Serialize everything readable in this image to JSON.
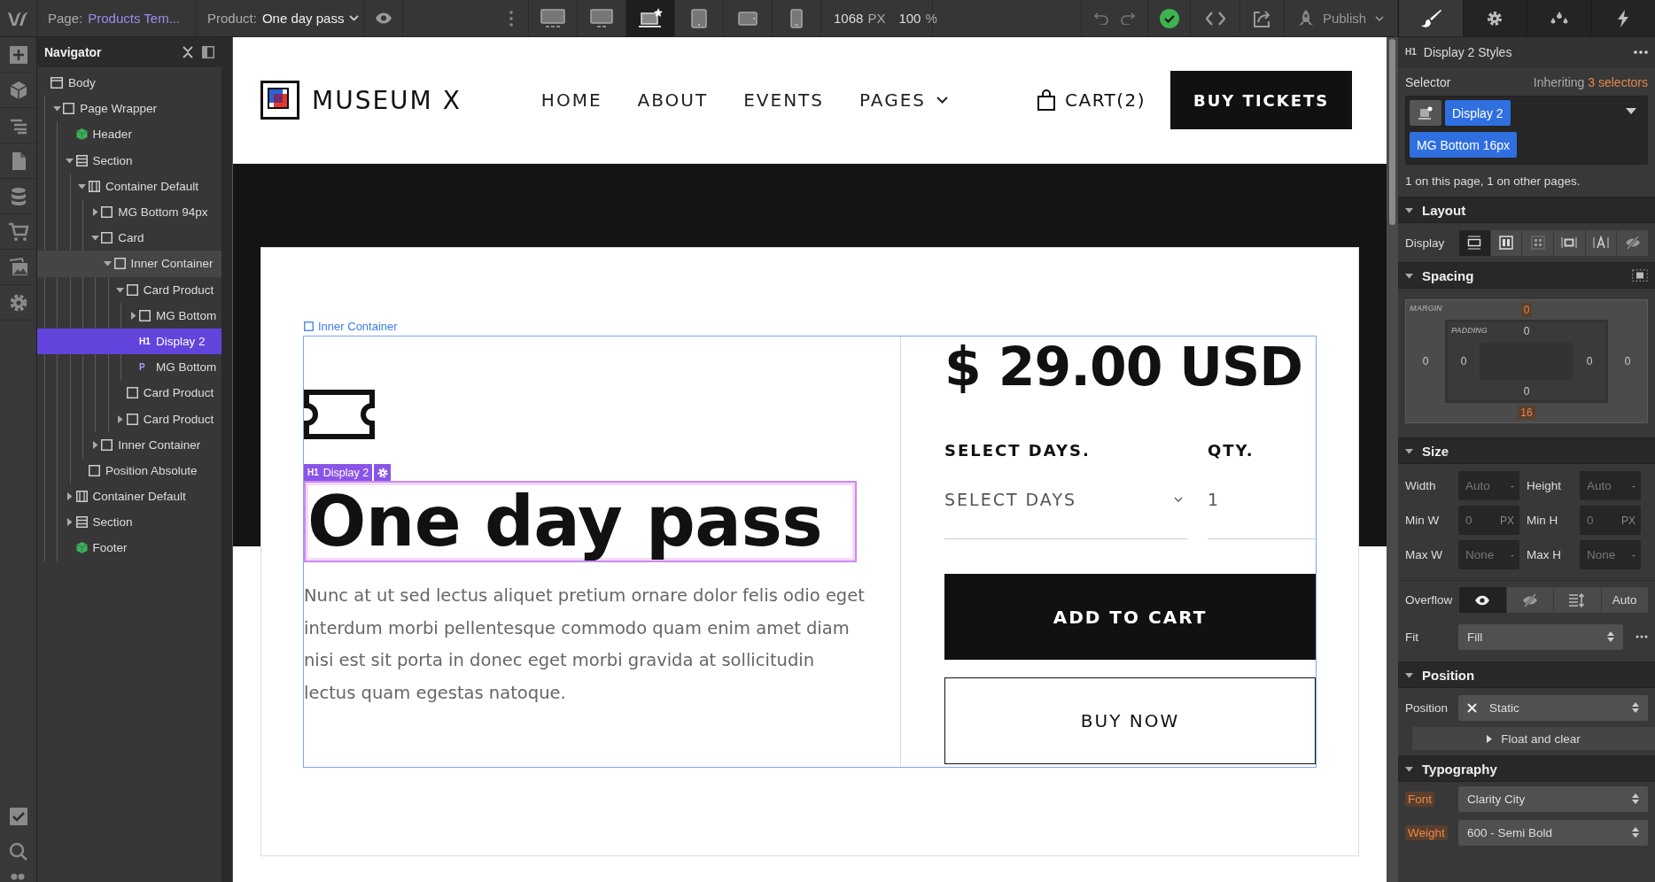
{
  "topbar": {
    "page_label": "Page:",
    "page_name": "Products Tem...",
    "product_label": "Product:",
    "product_name": "One day pass",
    "devices": [
      {
        "selected": false
      },
      {
        "selected": false
      },
      {
        "selected": true
      },
      {
        "selected": false
      },
      {
        "selected": false
      },
      {
        "selected": false
      }
    ],
    "width_value": "1068",
    "width_unit": "PX",
    "zoom_value": "100",
    "zoom_unit": "%",
    "publish": "Publish"
  },
  "panel_tabs": [
    {
      "selected": true
    },
    {
      "selected": false
    },
    {
      "selected": false
    },
    {
      "selected": false
    }
  ],
  "navigator": {
    "title": "Navigator",
    "items": [
      {
        "label": "Body",
        "kind": "body",
        "selected": false,
        "highlighted": false,
        "children": [
          {
            "label": "Page Wrapper",
            "kind": "box",
            "expanded": true,
            "selected": false,
            "highlighted": false,
            "children": [
              {
                "label": "Header",
                "kind": "component",
                "selected": false,
                "highlighted": false
              },
              {
                "label": "Section",
                "kind": "section",
                "expanded": true,
                "selected": false,
                "highlighted": false,
                "children": [
                  {
                    "label": "Container Default",
                    "kind": "container",
                    "expanded": true,
                    "selected": false,
                    "highlighted": false,
                    "children": [
                      {
                        "label": "MG Bottom 94px",
                        "kind": "box",
                        "expanded": false,
                        "selected": false,
                        "highlighted": false
                      },
                      {
                        "label": "Card",
                        "kind": "box",
                        "expanded": true,
                        "selected": false,
                        "highlighted": false,
                        "children": [
                          {
                            "label": "Inner Container",
                            "kind": "box",
                            "expanded": true,
                            "selected": false,
                            "highlighted": true,
                            "children": [
                              {
                                "label": "Card Product",
                                "kind": "box",
                                "expanded": true,
                                "selected": false,
                                "highlighted": false,
                                "children": [
                                  {
                                    "label": "MG Bottom",
                                    "kind": "box",
                                    "expanded": false,
                                    "selected": false,
                                    "highlighted": false
                                  },
                                  {
                                    "label": "Display 2",
                                    "kind": "tag",
                                    "tag": "H1",
                                    "selected": true,
                                    "highlighted": false
                                  },
                                  {
                                    "label": "MG Bottom",
                                    "kind": "tag",
                                    "tag": "P",
                                    "selected": false,
                                    "highlighted": false
                                  }
                                ]
                              },
                              {
                                "label": "Card Product",
                                "kind": "box",
                                "selected": false,
                                "highlighted": false
                              },
                              {
                                "label": "Card Product",
                                "kind": "box",
                                "expanded": false,
                                "selected": false,
                                "highlighted": false
                              }
                            ]
                          }
                        ]
                      },
                      {
                        "label": "Inner Container",
                        "kind": "box",
                        "expanded": false,
                        "selected": false,
                        "highlighted": false
                      }
                    ]
                  },
                  {
                    "label": "Position Absolute",
                    "kind": "box",
                    "selected": false,
                    "highlighted": false
                  }
                ]
              },
              {
                "label": "Container Default",
                "kind": "container",
                "expanded": false,
                "selected": false,
                "highlighted": false
              },
              {
                "label": "Section",
                "kind": "section",
                "expanded": false,
                "selected": false,
                "highlighted": false
              },
              {
                "label": "Footer",
                "kind": "component",
                "selected": false,
                "highlighted": false
              }
            ]
          }
        ]
      }
    ]
  },
  "site": {
    "brand": "MUSEUM X",
    "nav": [
      {
        "label": "HOME",
        "dropdown": false
      },
      {
        "label": "ABOUT",
        "dropdown": false
      },
      {
        "label": "EVENTS",
        "dropdown": false
      },
      {
        "label": "PAGES",
        "dropdown": true
      }
    ],
    "cart": "CART(2)",
    "cta": "BUY TICKETS"
  },
  "selection": {
    "parent_label": "Inner Container",
    "tag": "H1",
    "label": "Display 2"
  },
  "product": {
    "title": "One day pass",
    "description": "Nunc at ut sed lectus aliquet pretium ornare dolor felis odio eget interdum morbi pellentesque commodo quam enim amet diam nisi est sit porta in donec eget morbi gravida at sollicitudin lectus quam egestas natoque.",
    "price": "$ 29.00 USD",
    "days_label": "SELECT DAYS.",
    "qty_label": "QTY.",
    "days_placeholder": "SELECT DAYS",
    "qty_value": "1",
    "add_button": "ADD TO CART",
    "buy_button": "BUY NOW"
  },
  "style_panel": {
    "tag": "H1",
    "title": "Display 2 Styles",
    "selector_label": "Selector",
    "inheriting_prefix": "Inheriting",
    "inheriting_count": "3 selectors",
    "selectors": [
      "Display 2",
      "MG Bottom 16px"
    ],
    "usage": "1 on this page, 1 on other pages.",
    "layout": {
      "title": "Layout",
      "display_label": "Display",
      "display_options": [
        {
          "selected": true
        },
        {
          "selected": false
        },
        {
          "selected": false
        },
        {
          "selected": false
        },
        {
          "selected": false
        },
        {
          "selected": false
        }
      ]
    },
    "spacing": {
      "title": "Spacing",
      "margin_label": "MARGIN",
      "padding_label": "PADDING",
      "margin": {
        "top": {
          "value": "0",
          "set": true
        },
        "right": {
          "value": "0",
          "set": false
        },
        "bottom": {
          "value": "16",
          "set": true
        },
        "left": {
          "value": "0",
          "set": false
        }
      },
      "padding": {
        "top": {
          "value": "0",
          "set": false
        },
        "right": {
          "value": "0",
          "set": false
        },
        "bottom": {
          "value": "0",
          "set": false
        },
        "left": {
          "value": "0",
          "set": false
        }
      }
    },
    "size": {
      "title": "Size",
      "fields": [
        {
          "label": "Width",
          "placeholder": "Auto",
          "unit": "-"
        },
        {
          "label": "Height",
          "placeholder": "Auto",
          "unit": "-"
        },
        {
          "label": "Min W",
          "placeholder": "0",
          "unit": "PX"
        },
        {
          "label": "Min H",
          "placeholder": "0",
          "unit": "PX"
        },
        {
          "label": "Max W",
          "placeholder": "None",
          "unit": "-"
        },
        {
          "label": "Max H",
          "placeholder": "None",
          "unit": "-"
        }
      ],
      "overflow_label": "Overflow",
      "overflow_options": [
        {
          "selected": true
        },
        {
          "selected": false
        },
        {
          "selected": false
        },
        {
          "label": "Auto",
          "selected": false
        }
      ],
      "fit_label": "Fit",
      "fit_value": "Fill"
    },
    "position": {
      "title": "Position",
      "position_label": "Position",
      "position_value": "Static",
      "float_label": "Float and clear"
    },
    "typography": {
      "title": "Typography",
      "rows": [
        {
          "label": "Font",
          "value": "Clarity City",
          "set": true
        },
        {
          "label": "Weight",
          "value": "600 - Semi Bold",
          "set": true
        }
      ]
    }
  }
}
